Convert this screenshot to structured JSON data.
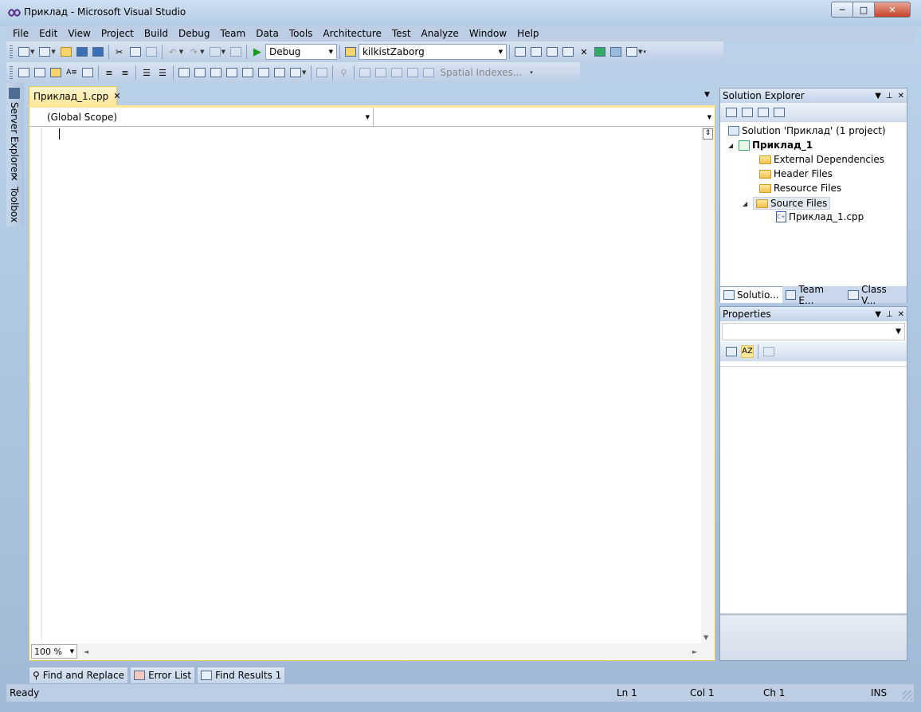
{
  "window": {
    "title": "Приклад - Microsoft Visual Studio",
    "controls": {
      "minimize": "─",
      "maximize": "□",
      "close": "✕"
    }
  },
  "menu": [
    "File",
    "Edit",
    "View",
    "Project",
    "Build",
    "Debug",
    "Team",
    "Data",
    "Tools",
    "Architecture",
    "Test",
    "Analyze",
    "Window",
    "Help"
  ],
  "toolbar": {
    "configuration": "Debug",
    "find_target": "kilkistZaborg",
    "spatial_indexes": "Spatial Indexes..."
  },
  "side_tabs": {
    "server_explorer": "Server Explorer",
    "toolbox": "Toolbox"
  },
  "editor": {
    "tab_label": "Приклад_1.cpp",
    "scope": "(Global Scope)",
    "member": "",
    "zoom": "100 %"
  },
  "solution_explorer": {
    "title": "Solution Explorer",
    "solution": "Solution 'Приклад' (1 project)",
    "project": "Приклад_1",
    "folders": [
      "External Dependencies",
      "Header Files",
      "Resource Files",
      "Source Files"
    ],
    "source_file": "Приклад_1.cpp",
    "tabs": [
      "Solutio...",
      "Team E...",
      "Class V..."
    ]
  },
  "properties": {
    "title": "Properties",
    "object": ""
  },
  "bottom_tabs": [
    "Find and Replace",
    "Error List",
    "Find Results 1"
  ],
  "status": {
    "ready": "Ready",
    "line": "Ln 1",
    "col": "Col 1",
    "ch": "Ch 1",
    "mode": "INS"
  },
  "colors": {
    "accent_doc_tab": "#fde79a",
    "chrome": "#bccde4"
  }
}
